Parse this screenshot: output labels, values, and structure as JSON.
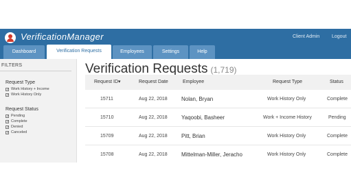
{
  "app": {
    "title": "VerificationManager",
    "user_link": "Client Admin",
    "logout_link": "Logout"
  },
  "tabs": [
    {
      "label": "Dashboard",
      "active": false
    },
    {
      "label": "Verification Requests",
      "active": true
    },
    {
      "label": "Employees",
      "active": false
    },
    {
      "label": "Settings",
      "active": false
    },
    {
      "label": "Help",
      "active": false
    }
  ],
  "filters": {
    "title": "FILTERS",
    "request_type": {
      "title": "Request Type",
      "options": [
        {
          "label": "Work History + Income",
          "checked": true
        },
        {
          "label": "Work History Only",
          "checked": true
        }
      ]
    },
    "request_status": {
      "title": "Request Status",
      "options": [
        {
          "label": "Pending",
          "checked": true
        },
        {
          "label": "Complete",
          "checked": true
        },
        {
          "label": "Denied",
          "checked": true
        },
        {
          "label": "Canceled",
          "checked": true
        }
      ]
    }
  },
  "main": {
    "title": "Verification Requests",
    "count": "(1,719)"
  },
  "table": {
    "columns": [
      {
        "label": "Request ID",
        "sort_icon": "▾"
      },
      {
        "label": "Request Date"
      },
      {
        "label": "Employee"
      },
      {
        "label": "Request Type"
      },
      {
        "label": "Status"
      }
    ],
    "rows": [
      {
        "id": "15711",
        "date": "Aug 22, 2018",
        "employee": "Nolan, Bryan",
        "type": "Work History Only",
        "status": "Complete"
      },
      {
        "id": "15710",
        "date": "Aug 22, 2018",
        "employee": "Yaqoobi, Basheer",
        "type": "Work + Income History",
        "status": "Pending"
      },
      {
        "id": "15709",
        "date": "Aug 22, 2018",
        "employee": "Pitt, Brian",
        "type": "Work History Only",
        "status": "Complete"
      },
      {
        "id": "15708",
        "date": "Aug 22, 2018",
        "employee": "Mittelman-Miller, Jeracho",
        "type": "Work History Only",
        "status": "Complete"
      }
    ]
  },
  "colors": {
    "header_blue": "#2e6ea3",
    "tab_blue": "#5d93c2",
    "logo_red": "#d23a2c"
  }
}
